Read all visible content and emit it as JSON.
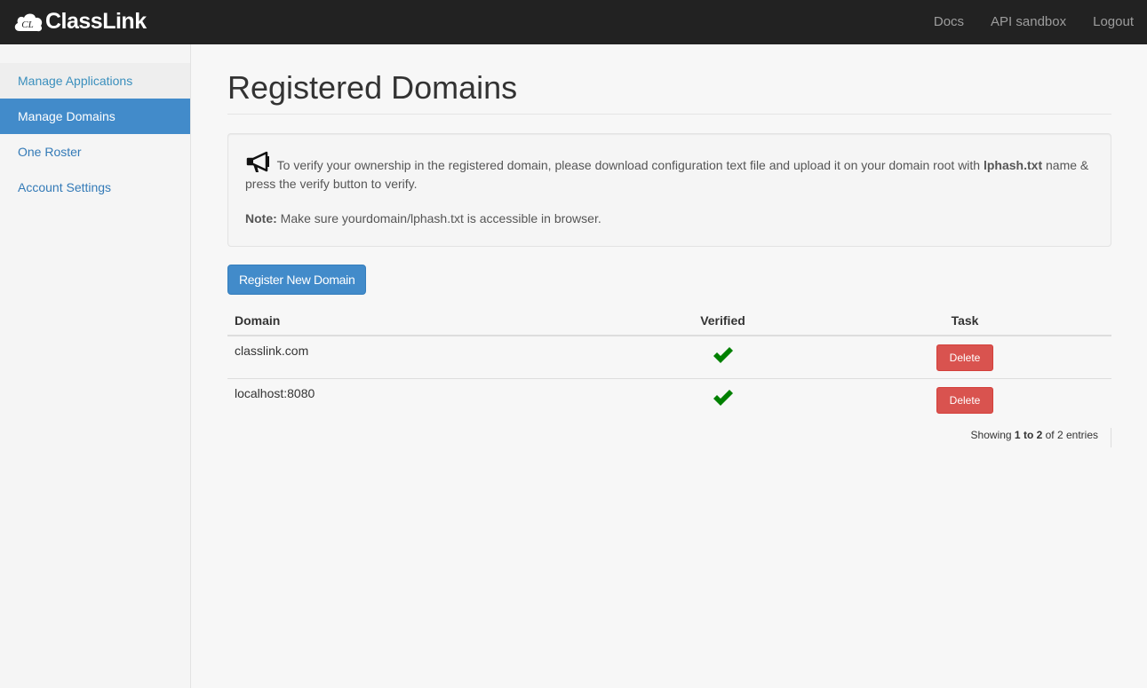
{
  "navbar": {
    "brand": "ClassLink",
    "links": [
      "Docs",
      "API sandbox",
      "Logout"
    ]
  },
  "sidebar": {
    "items": [
      {
        "label": "Manage Applications"
      },
      {
        "label": "Manage Domains"
      },
      {
        "label": "One Roster"
      },
      {
        "label": "Account Settings"
      }
    ]
  },
  "main": {
    "title": "Registered Domains",
    "info": {
      "text_before": " To verify your ownership in the registered domain, please download configuration text file and upload it on your domain root with ",
      "file_name": "lphash.txt",
      "text_after": " name & press the verify button to verify.",
      "note_label": "Note:",
      "note_text": " Make sure yourdomain/lphash.txt is accessible in browser."
    },
    "register_button": "Register New Domain",
    "table": {
      "headers": [
        "Domain",
        "Verified",
        "Task"
      ],
      "rows": [
        {
          "domain": "classlink.com",
          "verified": true,
          "task": "Delete"
        },
        {
          "domain": "localhost:8080",
          "verified": true,
          "task": "Delete"
        }
      ]
    },
    "pagination_info": {
      "prefix": "Showing ",
      "from": "1",
      "to_word": " to ",
      "to": "2",
      "suffix": " of 2 entries"
    }
  },
  "colors": {
    "navbar_bg": "#222222",
    "primary": "#428bca",
    "danger": "#d9534f",
    "verified_check": "#008000"
  }
}
